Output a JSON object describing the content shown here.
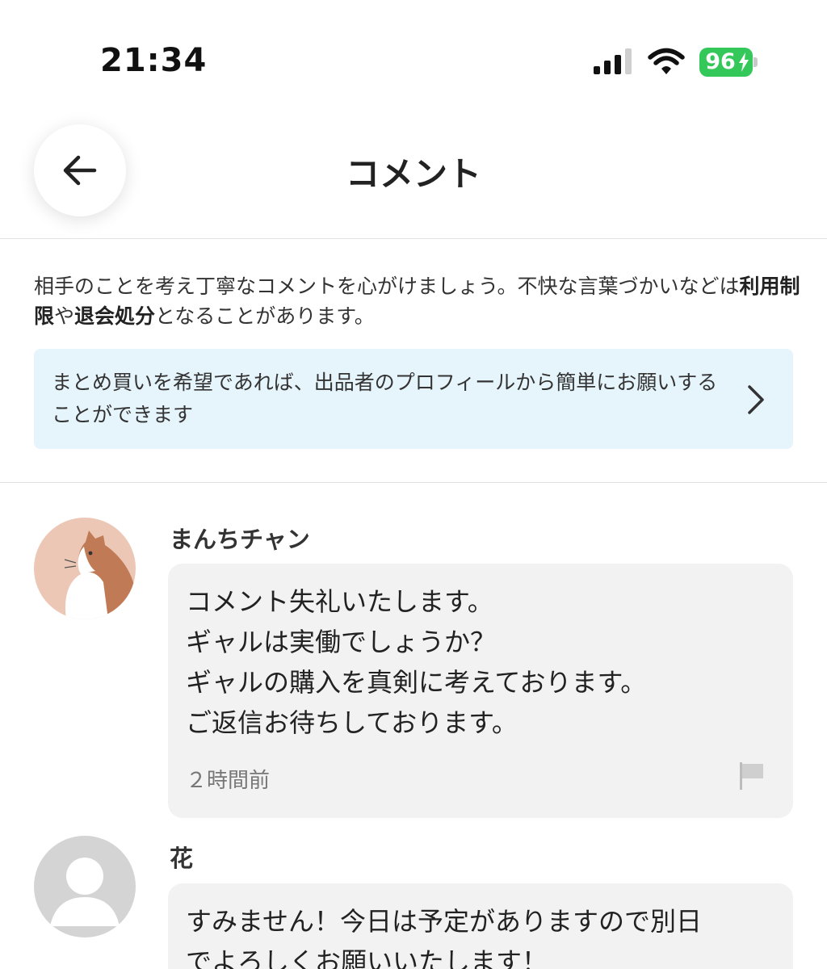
{
  "status_bar": {
    "time": "21:34",
    "battery_level": "96",
    "battery_color": "#34c759"
  },
  "header": {
    "title": "コメント",
    "back_icon": "arrow-left-icon"
  },
  "notice": {
    "part1": "相手のことを考え丁寧なコメントを心がけましょう。不快な言葉づかいなどは",
    "bold1": "利用制限",
    "part2": "や",
    "bold2": "退会処分",
    "part3": "となることがあります。"
  },
  "banner": {
    "text": "まとめ買いを希望であれば、出品者のプロフィールから簡単にお願いすることができます",
    "icon": "chevron-right-icon",
    "background": "#e6f4fc"
  },
  "comments": [
    {
      "user": "まんちチャン",
      "avatar": "cat-avatar",
      "text": "コメント失礼いたします。\nギャルは実働でしょうか？\nギャルの購入を真剣に考えております。\nご返信お待ちしております。",
      "time": "２時間前",
      "flag_icon": "flag-icon"
    },
    {
      "user": "花",
      "avatar": "default-user-avatar",
      "text": "すみません！今日は予定がありますので別日\nでよろしくお願いいたします！"
    }
  ]
}
